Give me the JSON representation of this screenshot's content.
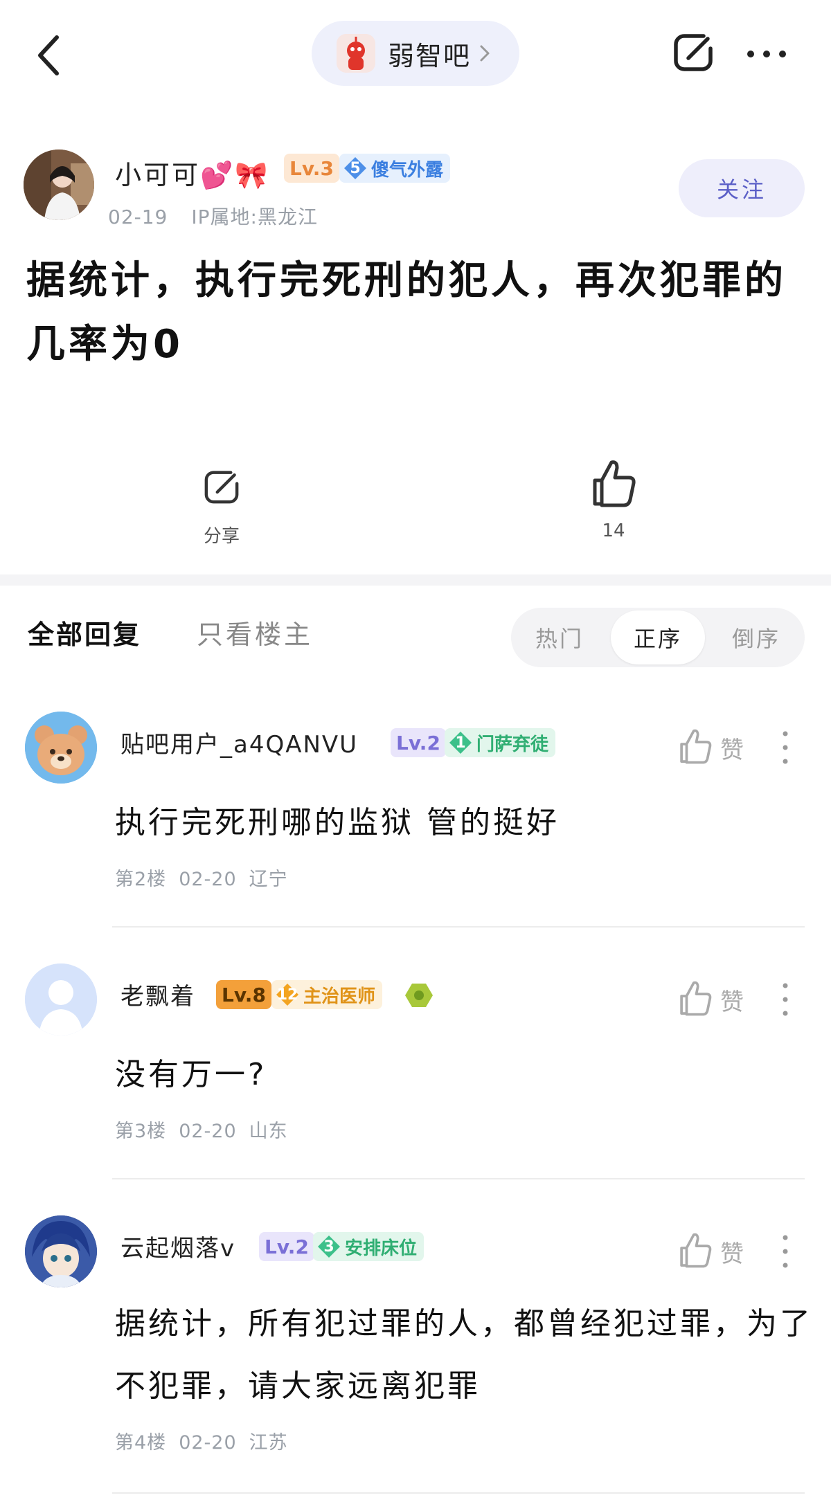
{
  "nav": {
    "forum_name": "弱智吧"
  },
  "post": {
    "author": {
      "name": "小可可💕🎀",
      "level": "Lv.3",
      "title_num": "5",
      "title": "傻气外露"
    },
    "date": "02-19",
    "ip_location": "IP属地:黑龙江",
    "follow_label": "关注",
    "title": "据统计，执行完死刑的犯人，再次犯罪的几率为0",
    "share_label": "分享",
    "like_count": "14"
  },
  "replies_header": {
    "tabs": [
      "全部回复",
      "只看楼主"
    ],
    "sort_options": [
      "热门",
      "正序",
      "倒序"
    ],
    "active_sort": "正序"
  },
  "replies": [
    {
      "name": "贴吧用户_a4QANVU",
      "level": "Lv.2",
      "title_num": "1",
      "title": "门萨弃徒",
      "content": "执行完死刑哪的监狱 管的挺好",
      "floor": "第2楼",
      "date": "02-20",
      "location": "辽宁",
      "like_label": "赞"
    },
    {
      "name": "老飘着",
      "level": "Lv.8",
      "title_num": "12",
      "title": "主治医师",
      "content": "没有万一?",
      "floor": "第3楼",
      "date": "02-20",
      "location": "山东",
      "like_label": "赞"
    },
    {
      "name": "云起烟落v",
      "level": "Lv.2",
      "title_num": "3",
      "title": "安排床位",
      "content": "据统计，所有犯过罪的人，都曾经犯过罪，为了不犯罪，请大家远离犯罪",
      "floor": "第4楼",
      "date": "02-20",
      "location": "江苏",
      "like_label": "赞"
    }
  ],
  "colors": {
    "accent": "#5b5fc7",
    "lv3": "#f0a15a",
    "lv2": "#8f86d8",
    "lv8": "#e8902a",
    "badge_blue": "#4d8fe8",
    "badge_green": "#3cc08a",
    "badge_orange": "#f3a420"
  },
  "icons": [
    "back-chevron-icon",
    "chevron-right-icon",
    "share-icon",
    "more-dots-icon",
    "thumbs-up-icon",
    "vertical-more-icon"
  ]
}
